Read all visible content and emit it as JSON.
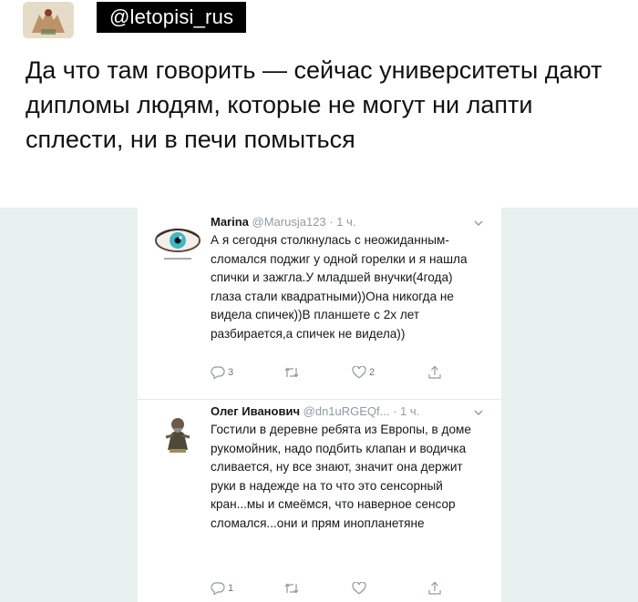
{
  "header": {
    "handle": "@letopisi_rus",
    "post_text": "Да что там говорить — сейчас университеты дают дипломы людям, которые не могут ни лапти сплести, ни в печи помыться"
  },
  "tweets": [
    {
      "name": "Marina",
      "meta": "@Marusja123 · 1 ч.",
      "text": "А я сегодня столкнулась с неожиданным-сломался поджиг у одной горелки и я нашла спички и зажгла.У младшей внучки(4года) глаза стали квадратными))Она никогда не видела спичек))В планшете с 2х лет разбирается,а спичек не видела))",
      "replies": "3",
      "likes": "2"
    },
    {
      "name": "Олег Иванович",
      "meta": "@dn1uRGEQf... · 1 ч.",
      "text": "Гостили в деревне ребята из Европы, в доме рукомойник, надо подбить клапан и водичка сливается, ну все знают, значит она держит руки в надежде на то что это сенсорный кран...мы и смеёмся, что наверное сенсор сломался...они и прям инопланетяне",
      "replies": "1",
      "likes": ""
    }
  ],
  "colors": {
    "panel_bg": "#e8f0f0",
    "icon_gray": "#8f9aa3"
  },
  "icons": [
    "reply-icon",
    "retweet-icon",
    "like-icon",
    "share-icon",
    "chevron-down-icon"
  ]
}
